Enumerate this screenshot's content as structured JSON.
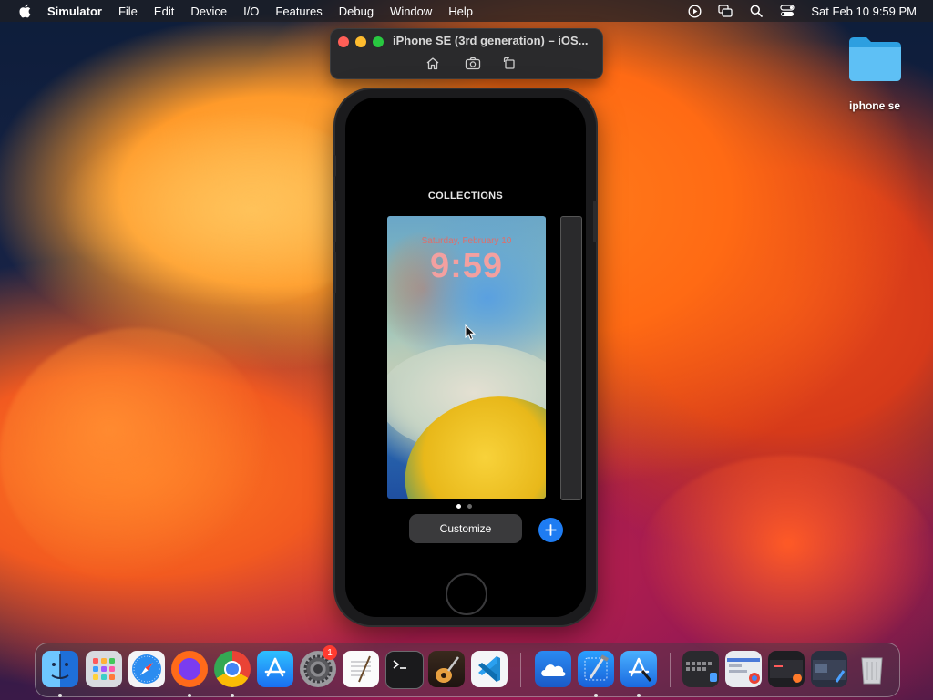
{
  "menubar": {
    "app_name": "Simulator",
    "items": [
      "File",
      "Edit",
      "Device",
      "I/O",
      "Features",
      "Debug",
      "Window",
      "Help"
    ],
    "clock": "Sat Feb 10  9:59 PM",
    "status_icons": [
      "screen-recording-icon",
      "screen-mirroring-icon",
      "spotlight-search-icon",
      "control-center-icon"
    ]
  },
  "simulator_window": {
    "title": "iPhone SE (3rd generation) – iOS...",
    "toolbar": [
      "home-icon",
      "screenshot-icon",
      "rotate-icon"
    ]
  },
  "phone": {
    "section_title": "COLLECTIONS",
    "lock_screen": {
      "date": "Saturday, February 10",
      "time": "9:59"
    },
    "pages": {
      "count": 2,
      "current": 1
    },
    "customize_label": "Customize",
    "add_icon": "plus-icon"
  },
  "desktop": {
    "folder_label": "iphone se"
  },
  "dock": {
    "apps": [
      {
        "name": "Finder",
        "icon": "finder-icon",
        "running": true
      },
      {
        "name": "Launchpad",
        "icon": "launchpad-icon",
        "running": false
      },
      {
        "name": "Safari",
        "icon": "safari-icon",
        "running": false
      },
      {
        "name": "Firefox",
        "icon": "firefox-icon",
        "running": true
      },
      {
        "name": "Google Chrome",
        "icon": "chrome-icon",
        "running": true
      },
      {
        "name": "App Store",
        "icon": "app-store-icon",
        "running": false
      },
      {
        "name": "System Settings",
        "icon": "system-settings-icon",
        "running": false,
        "badge": "1"
      },
      {
        "name": "TextEdit",
        "icon": "textedit-icon",
        "running": false
      },
      {
        "name": "Terminal",
        "icon": "terminal-icon",
        "running": false
      },
      {
        "name": "GarageBand",
        "icon": "garageband-icon",
        "running": false
      },
      {
        "name": "Visual Studio Code",
        "icon": "vscode-icon",
        "running": false
      },
      {
        "name": "iCloud",
        "icon": "icloud-icon",
        "running": false
      },
      {
        "name": "Xcode",
        "icon": "xcode-icon",
        "running": true
      },
      {
        "name": "Simulator",
        "icon": "simulator-icon",
        "running": true
      }
    ],
    "minimized_windows": [
      "window-thumbnail-1",
      "window-thumbnail-2",
      "window-thumbnail-3",
      "window-thumbnail-4"
    ],
    "trash_icon": "trash-icon"
  },
  "colors": {
    "accent_blue": "#1e7cf2",
    "badge_red": "#ff3b30",
    "clock_pink": "#f3a0a0"
  }
}
